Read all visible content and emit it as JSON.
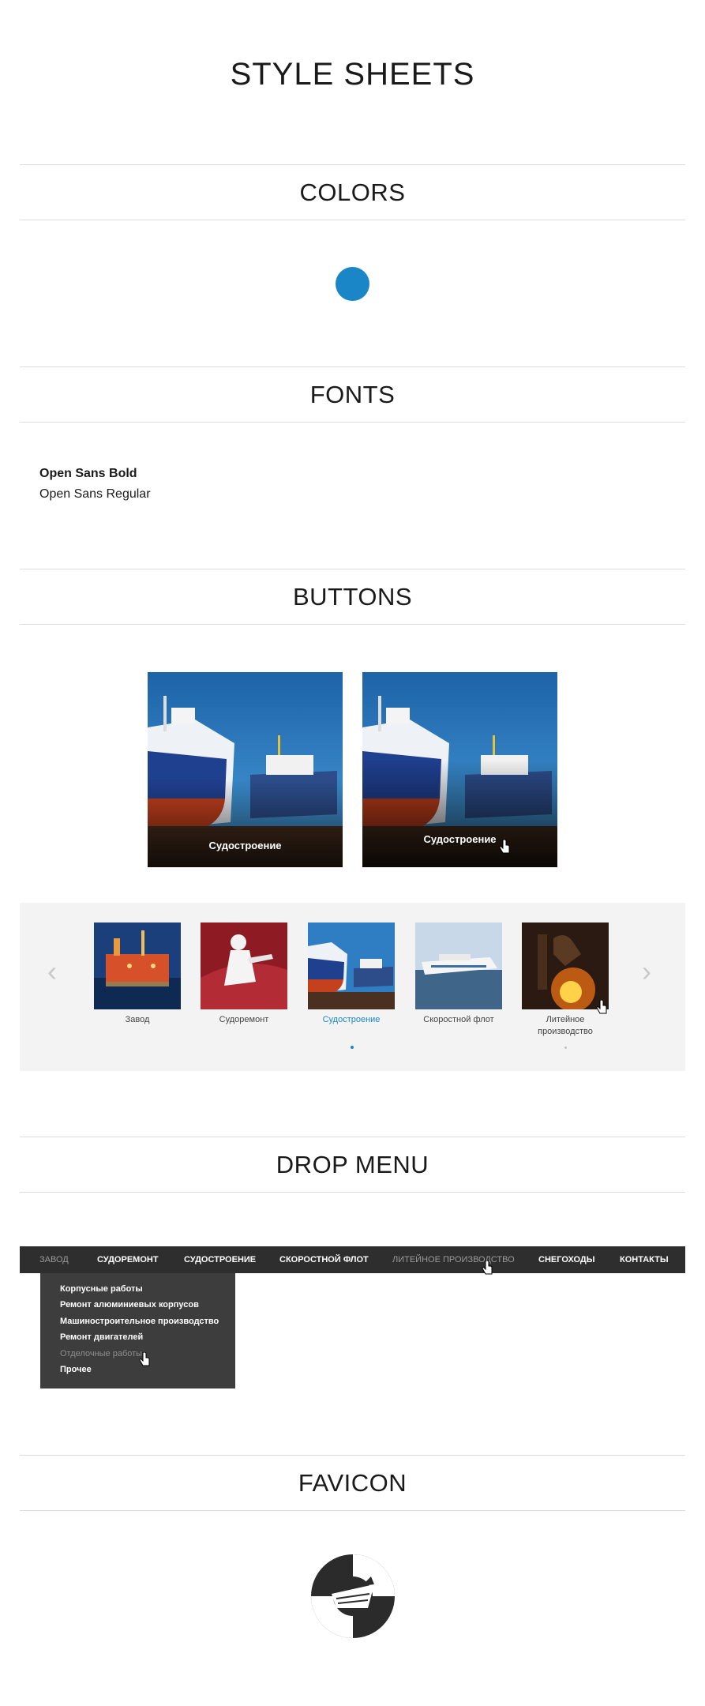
{
  "page": {
    "title": "STYLE SHEETS"
  },
  "sections": {
    "colors": "COLORS",
    "fonts": "FONTS",
    "buttons": "BUTTONS",
    "drop_menu": "DROP MENU",
    "favicon": "FAVICON"
  },
  "colors": {
    "primary": "#1a86c8"
  },
  "fonts": {
    "bold": "Open Sans Bold",
    "regular": "Open Sans Regular"
  },
  "buttons": {
    "card_normal": "Судостроение",
    "card_hover": "Судостроение"
  },
  "carousel": {
    "items": [
      {
        "label": "Завод",
        "icon": "oil-platform-image"
      },
      {
        "label": "Судоремонт",
        "icon": "painter-ship-image"
      },
      {
        "label": "Судостроение",
        "icon": "ship-dock-image"
      },
      {
        "label": "Скоростной флот",
        "icon": "hydrofoil-image"
      },
      {
        "label": "Литейное производство",
        "icon": "foundry-image"
      }
    ],
    "active_index": 2
  },
  "menu": {
    "items": [
      "ЗАВОД",
      "СУДОРЕМОНТ",
      "СУДОСТРОЕНИЕ",
      "СКОРОСТНОЙ ФЛОТ",
      "ЛИТЕЙНОЕ ПРОИЗВОДСТВО",
      "СНЕГОХОДЫ",
      "КОНТАКТЫ"
    ],
    "dropdown": [
      "Корпусные работы",
      "Ремонт алюминиевых корпусов",
      "Машиностроительное производство",
      "Ремонт двигателей",
      "Отделочные работы",
      "Прочее"
    ]
  }
}
